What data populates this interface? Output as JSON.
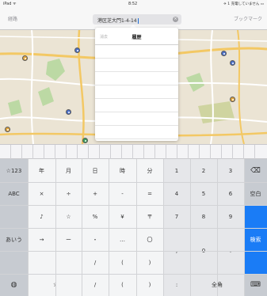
{
  "status_bar": {
    "device": "iPad ᯤ",
    "time": "8:52",
    "right": "✈ 1 充電していません ▭"
  },
  "toolbar": {
    "route_label": "経路",
    "bookmarks_label": "ブックマーク"
  },
  "search": {
    "value": "港区芝大門1-4-14",
    "clear_glyph": "×"
  },
  "popover": {
    "clear_label": "消去",
    "title": "履歴"
  },
  "keyboard": {
    "mode_numbers": "☆123",
    "mode_abc": "ABC",
    "mode_kana": "あいう",
    "globe": "◍",
    "hide_keyboard": "⌨",
    "delete": "⌫",
    "space": "空白",
    "search": "検索",
    "rows": [
      [
        "年",
        "月",
        "日",
        "時",
        "分"
      ],
      [
        "×",
        "÷",
        "+",
        "-",
        "="
      ],
      [
        "♪",
        "☆",
        "%",
        "¥",
        "〒"
      ],
      [
        "→",
        "ー",
        "・",
        "…",
        "〇"
      ],
      [
        "",
        "",
        "/",
        "(",
        ")"
      ]
    ],
    "numpad": [
      [
        "1",
        "2",
        "3"
      ],
      [
        "4",
        "5",
        "6"
      ],
      [
        "7",
        "8",
        "9"
      ],
      [
        ",",
        "0",
        "."
      ],
      [
        ":",
        "全角"
      ]
    ],
    "kana_toggle_glyph": "ゞ"
  }
}
